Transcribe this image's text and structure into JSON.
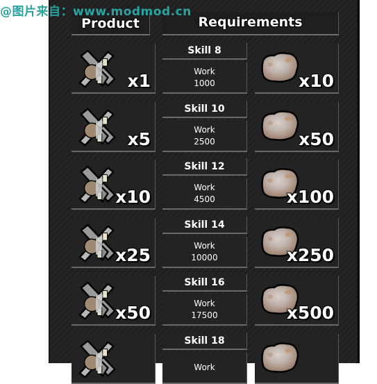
{
  "watermark": "@图片来自：www.modmod.cn",
  "header": {
    "product_label": "Product",
    "requirements_label": "Requirements"
  },
  "rows": [
    {
      "product_icon": "windmill-icon",
      "product_qty": "x1",
      "skill": "Skill 8",
      "work_label": "Work",
      "work_value": "1000",
      "material_icon": "stone-chunk-icon",
      "material_qty": "x10"
    },
    {
      "product_icon": "windmill-icon",
      "product_qty": "x5",
      "skill": "Skill 10",
      "work_label": "Work",
      "work_value": "2500",
      "material_icon": "stone-chunk-icon",
      "material_qty": "x50"
    },
    {
      "product_icon": "windmill-icon",
      "product_qty": "x10",
      "skill": "Skill 12",
      "work_label": "Work",
      "work_value": "4500",
      "material_icon": "stone-chunk-icon",
      "material_qty": "x100"
    },
    {
      "product_icon": "windmill-icon",
      "product_qty": "x25",
      "skill": "Skill 14",
      "work_label": "Work",
      "work_value": "10000",
      "material_icon": "stone-chunk-icon",
      "material_qty": "x250"
    },
    {
      "product_icon": "windmill-icon",
      "product_qty": "x50",
      "skill": "Skill 16",
      "work_label": "Work",
      "work_value": "17500",
      "material_icon": "stone-chunk-icon",
      "material_qty": "x500"
    },
    {
      "product_icon": "windmill-icon",
      "product_qty": "",
      "skill": "Skill 18",
      "work_label": "Work",
      "work_value": "",
      "material_icon": "stone-chunk-icon",
      "material_qty": ""
    }
  ]
}
